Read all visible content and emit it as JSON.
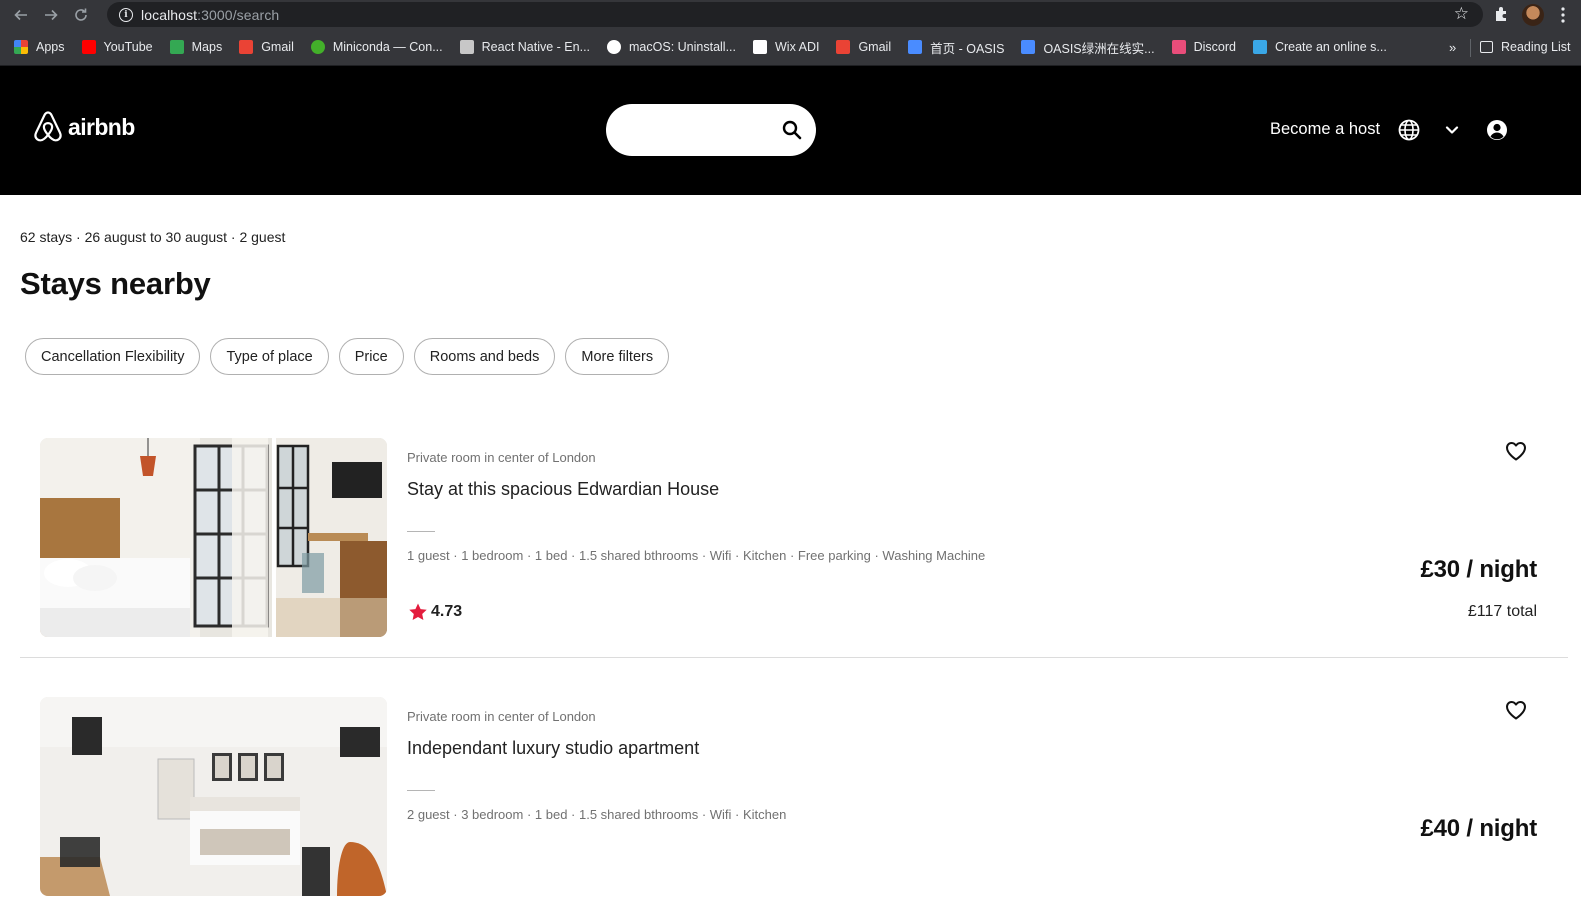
{
  "browser": {
    "url_host": "localhost",
    "url_path": ":3000/search",
    "bookmarks": [
      {
        "label": "Apps",
        "icon": "apps-grid-icon",
        "color": "#ea4335"
      },
      {
        "label": "YouTube",
        "icon": "youtube-icon",
        "color": "#ff0000"
      },
      {
        "label": "Maps",
        "icon": "maps-icon",
        "color": "#34a853"
      },
      {
        "label": "Gmail",
        "icon": "gmail-icon",
        "color": "#ea4335"
      },
      {
        "label": "Miniconda — Con...",
        "icon": "miniconda-icon",
        "color": "#43b02a"
      },
      {
        "label": "React Native - En...",
        "icon": "react-native-icon",
        "color": "#c7c7c7"
      },
      {
        "label": "macOS: Uninstall...",
        "icon": "github-icon",
        "color": "#ffffff"
      },
      {
        "label": "Wix ADI",
        "icon": "wix-icon",
        "color": "#ffffff"
      },
      {
        "label": "Gmail",
        "icon": "gmail-icon",
        "color": "#ea4335"
      },
      {
        "label": "首页 - OASIS",
        "icon": "oasis-icon",
        "color": "#4a8cff"
      },
      {
        "label": "OASIS绿洲在线实...",
        "icon": "oasis-icon",
        "color": "#4a8cff"
      },
      {
        "label": "Discord",
        "icon": "discord-icon",
        "color": "#e94d7a"
      },
      {
        "label": "Create an online s...",
        "icon": "create-online-icon",
        "color": "#3aa7e6"
      }
    ],
    "reading_list": "Reading List"
  },
  "header": {
    "logo": "airbnb",
    "search_placeholder": "",
    "host_link": "Become a host",
    "brand_color": "#000000"
  },
  "results": {
    "summary": "62 stays · 26 august to 30 august · 2 guest",
    "title": "Stays nearby",
    "filters": [
      "Cancellation Flexibility",
      "Type of place",
      "Price",
      "Rooms and beds",
      "More filters"
    ]
  },
  "listings": [
    {
      "subtitle": "Private room in center of London",
      "title": "Stay at this spacious Edwardian House",
      "amenities": "1 guest · 1 bedroom · 1 bed · 1.5 shared bthrooms · Wifi · Kitchen · Free parking · Washing Machine",
      "rating": "4.73",
      "price": "£30 / night",
      "total": "£117 total"
    },
    {
      "subtitle": "Private room in center of London",
      "title": "Independant luxury studio apartment",
      "amenities": "2 guest · 3 bedroom · 1 bed · 1.5 shared bthrooms · Wifi · Kitchen",
      "price": "£40 / night"
    }
  ],
  "colors": {
    "star": "#e31c3d",
    "muted_text": "#717171"
  }
}
